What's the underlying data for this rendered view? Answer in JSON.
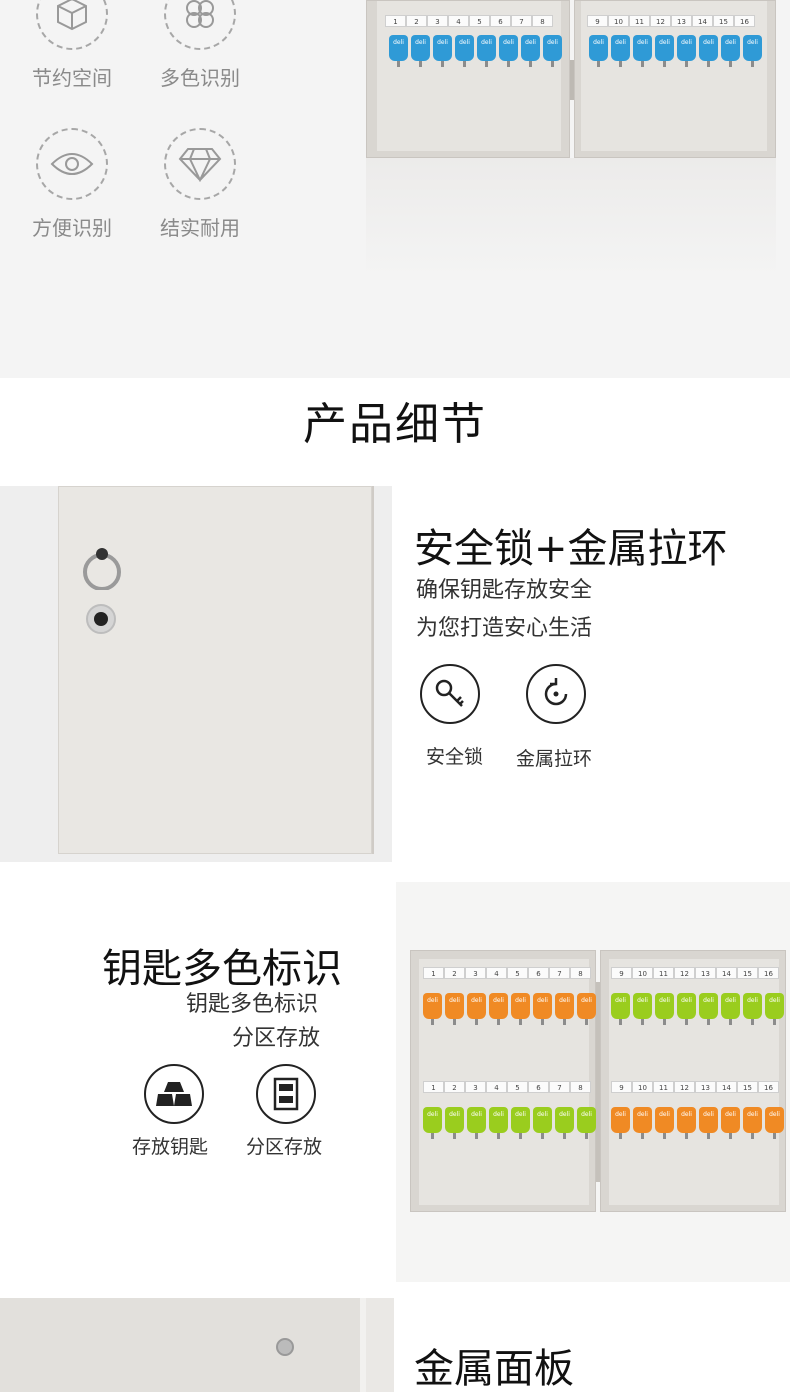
{
  "features": [
    {
      "label": "节约空间",
      "icon": "cube-icon"
    },
    {
      "label": "多色识别",
      "icon": "clover-icon"
    },
    {
      "label": "方便识别",
      "icon": "eye-icon"
    },
    {
      "label": "结实耐用",
      "icon": "diamond-icon"
    }
  ],
  "section_title": "产品细节",
  "lock_section": {
    "heading": "安全锁+金属拉环",
    "line1": "确保钥匙存放安全",
    "line2": "为您打造安心生活",
    "icon1_label": "安全锁",
    "icon2_label": "金属拉环"
  },
  "color_section": {
    "heading": "钥匙多色标识",
    "line1": "钥匙多色标识",
    "line2": "分区存放",
    "icon1_label": "存放钥匙",
    "icon2_label": "分区存放"
  },
  "metal_section": {
    "heading": "金属面板"
  },
  "cabinet_numbers_left": [
    "1",
    "2",
    "3",
    "4",
    "5",
    "6",
    "7",
    "8"
  ],
  "cabinet_numbers_right": [
    "9",
    "10",
    "11",
    "12",
    "13",
    "14",
    "15",
    "16"
  ],
  "key_brand": "deli",
  "colors": {
    "key_blue": "#2f9ad6",
    "key_orange": "#f08a24",
    "key_green": "#9acd1e",
    "cabinet": "#dcd9d4"
  }
}
